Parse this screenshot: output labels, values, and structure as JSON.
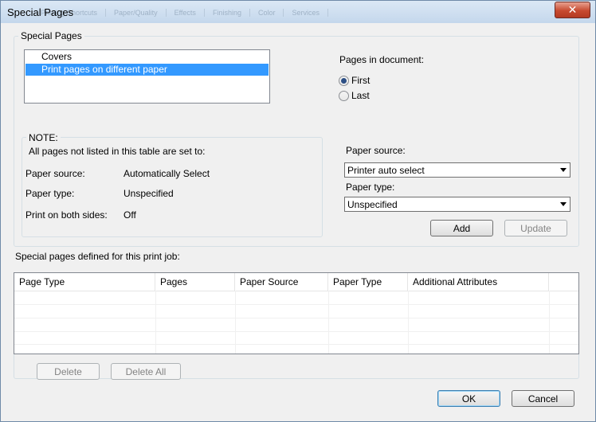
{
  "window": {
    "title": "Special Pages",
    "ghost_tabs": [
      "Printing Shortcuts",
      "Paper/Quality",
      "Effects",
      "Finishing",
      "Color",
      "Services"
    ]
  },
  "special_pages_group": {
    "label": "Special Pages",
    "list": [
      {
        "label": "Covers",
        "selected": false
      },
      {
        "label": "Print pages on different paper",
        "selected": true
      }
    ],
    "pages_in_document": {
      "label": "Pages in document:",
      "options": [
        {
          "label": "First",
          "checked": true
        },
        {
          "label": "Last",
          "checked": false
        }
      ]
    },
    "note": {
      "label": "NOTE:",
      "text": "All pages not listed in this table are set to:",
      "rows": [
        {
          "key": "Paper source:",
          "value": "Automatically Select"
        },
        {
          "key": "Paper type:",
          "value": "Unspecified"
        },
        {
          "key": "Print on both sides:",
          "value": "Off"
        }
      ]
    },
    "paper_source": {
      "label": "Paper source:",
      "value": "Printer auto select"
    },
    "paper_type": {
      "label": "Paper type:",
      "value": "Unspecified"
    },
    "add_button": "Add",
    "update_button": "Update"
  },
  "defined_section": {
    "label": "Special pages defined for this print job:",
    "columns": [
      "Page Type",
      "Pages",
      "Paper Source",
      "Paper Type",
      "Additional Attributes"
    ],
    "delete_button": "Delete",
    "delete_all_button": "Delete All"
  },
  "footer": {
    "ok_button": "OK",
    "cancel_button": "Cancel"
  },
  "colors": {
    "selection": "#3399ff",
    "dialog_bg": "#f0f0f0",
    "close_button": "#c74a30"
  }
}
